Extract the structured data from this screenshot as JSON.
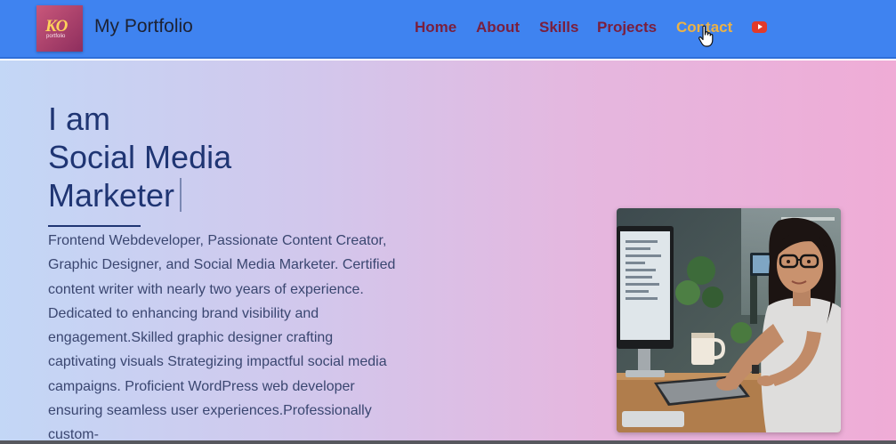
{
  "header": {
    "logo": {
      "mark": "KO",
      "tagline": "portfolio"
    },
    "brand": "My Portfolio",
    "nav": [
      {
        "label": "Home"
      },
      {
        "label": "About"
      },
      {
        "label": "Skills"
      },
      {
        "label": "Projects"
      },
      {
        "label": "Contact"
      }
    ],
    "active_nav": "Contact",
    "social_icon": "youtube-icon"
  },
  "hero": {
    "heading_lines": [
      "I am",
      "Social Media",
      "Marketer"
    ],
    "intro": "Frontend Webdeveloper, Passionate Content Creator, Graphic Designer, and Social Media Marketer. Certified content writer with nearly two years of experience. Dedicated to enhancing brand visibility and engagement.Skilled graphic designer crafting captivating visuals Strategizing impactful social media campaigns. Proficient WordPress web developer ensuring seamless user experiences.Professionally custom-",
    "photo": "woman-working-at-computer-photo"
  },
  "colors": {
    "navbar": "#3f83f0",
    "nav_link": "#7a1f3d",
    "nav_active": "#ecb246",
    "heading": "#1f3573",
    "body_text": "#3a4670",
    "youtube": "#e23a2a"
  }
}
